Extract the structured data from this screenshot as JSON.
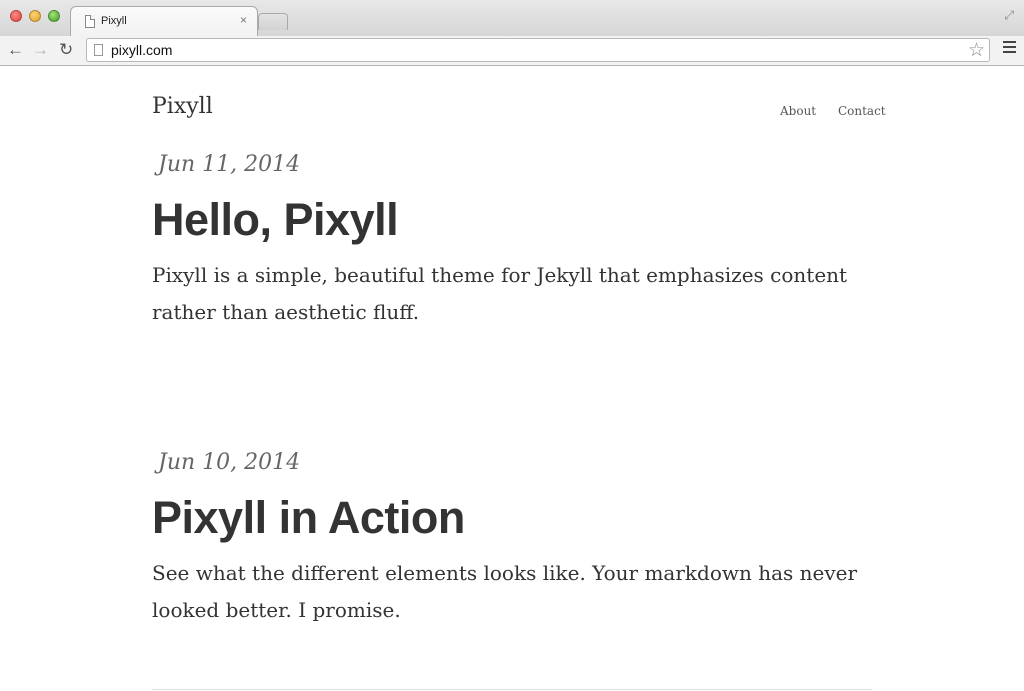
{
  "browser": {
    "tab_title": "Pixyll",
    "tab_close": "×",
    "url": "pixyll.com"
  },
  "icons": {
    "back": "arrow-left-icon",
    "forward": "arrow-right-icon",
    "reload": "reload-icon",
    "star": "star-icon",
    "menu": "menu-icon"
  },
  "site": {
    "title": "Pixyll",
    "nav": [
      {
        "label": "About"
      },
      {
        "label": "Contact"
      }
    ]
  },
  "posts": [
    {
      "date": "Jun 11, 2014",
      "title": "Hello, Pixyll",
      "summary": "Pixyll is a simple, beautiful theme for Jekyll that emphasizes content rather than aesthetic fluff."
    },
    {
      "date": "Jun 10, 2014",
      "title": "Pixyll in Action",
      "summary": "See what the different elements looks like. Your markdown has never looked better. I promise."
    }
  ]
}
